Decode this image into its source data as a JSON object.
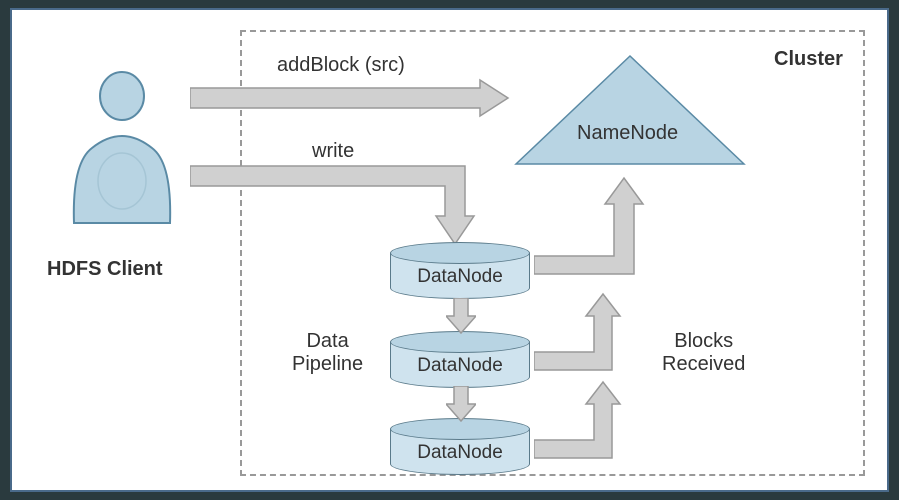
{
  "client_label": "HDFS Client",
  "cluster_label": "Cluster",
  "arrow_addblock": "addBlock (src)",
  "arrow_write": "write",
  "pipeline_label": "Data\nPipeline",
  "blocks_received_label": "Blocks\nReceived",
  "namenode_label": "NameNode",
  "datanodes": [
    "DataNode",
    "DataNode",
    "DataNode"
  ]
}
